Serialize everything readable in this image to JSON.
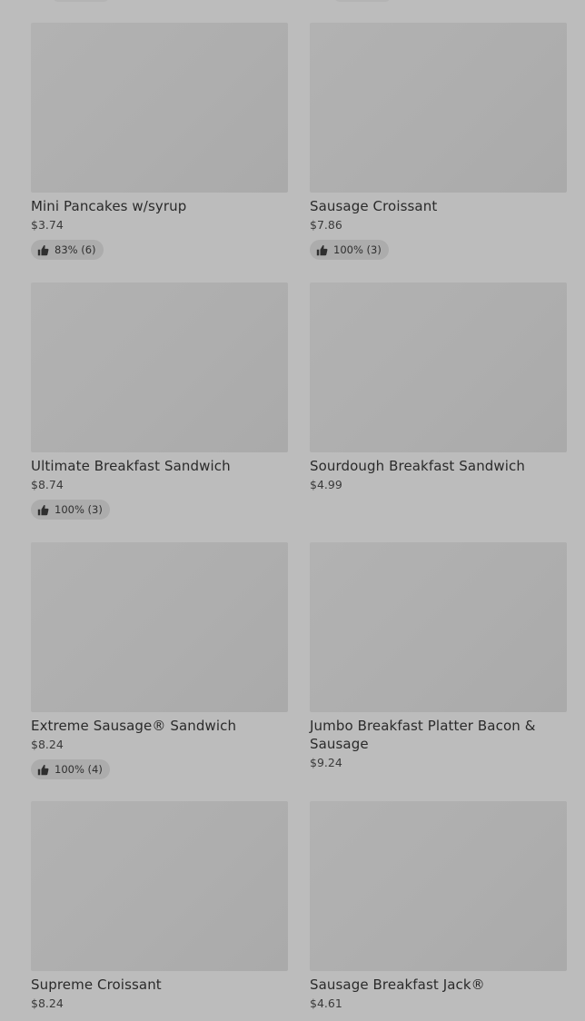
{
  "items": [
    {
      "name": "Mini Pancakes w/syrup",
      "price": "$3.74",
      "rating": "83% (6)"
    },
    {
      "name": "Sausage Croissant",
      "price": "$7.86",
      "rating": "100% (3)"
    },
    {
      "name": "Ultimate Breakfast Sandwich",
      "price": "$8.74",
      "rating": "100% (3)"
    },
    {
      "name": "Sourdough Breakfast Sandwich",
      "price": "$4.99",
      "rating": null
    },
    {
      "name": "Extreme Sausage® Sandwich",
      "price": "$8.24",
      "rating": "100% (4)"
    },
    {
      "name": "Jumbo Breakfast Platter Bacon & Sausage",
      "price": "$9.24",
      "rating": null
    },
    {
      "name": "Supreme Croissant",
      "price": "$8.24",
      "rating": null
    },
    {
      "name": "Sausage Breakfast Jack®",
      "price": "$4.61",
      "rating": null
    }
  ]
}
